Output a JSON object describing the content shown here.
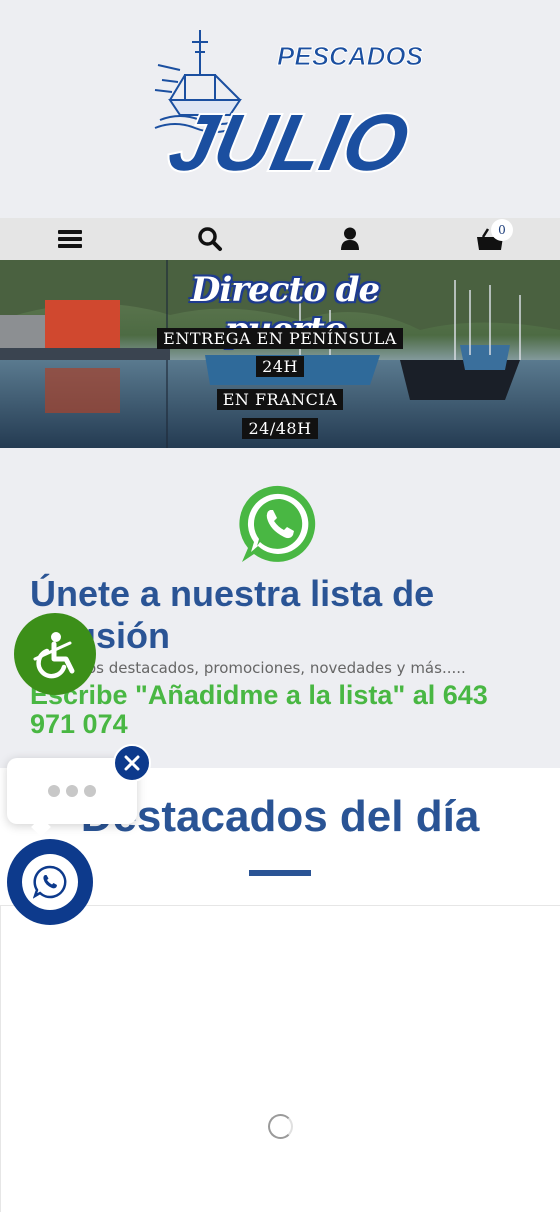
{
  "header": {
    "logo_top": "PESCADOS",
    "logo_main": "JULIO"
  },
  "nav": {
    "menu_icon": "hamburger-icon",
    "search_icon": "search-icon",
    "account_icon": "user-icon",
    "cart_icon": "cart-icon",
    "cart_count": "0"
  },
  "banner": {
    "title": "Directo de puerto",
    "line1": "ENTREGA EN PENÍNSULA",
    "line2": "24H",
    "line3": "EN FRANCIA",
    "line4": "24/48H"
  },
  "whatsapp_list": {
    "icon": "whatsapp-icon",
    "title": "Únete a nuestra lista de difusión",
    "subtitle": "Productos destacados, promociones, novedades y más.....",
    "cta": "Escribe \"Añadidme a la lista\" al 643 971 074"
  },
  "featured": {
    "title": "Destacados del día"
  },
  "floating": {
    "accessibility_icon": "accessibility-icon",
    "close_icon": "close-icon",
    "whatsapp_icon": "whatsapp-icon"
  },
  "colors": {
    "brand_blue": "#2a5495",
    "dark_blue": "#0d3a8c",
    "whatsapp_green": "#49b743",
    "accessibility_green": "#3c8f19"
  }
}
